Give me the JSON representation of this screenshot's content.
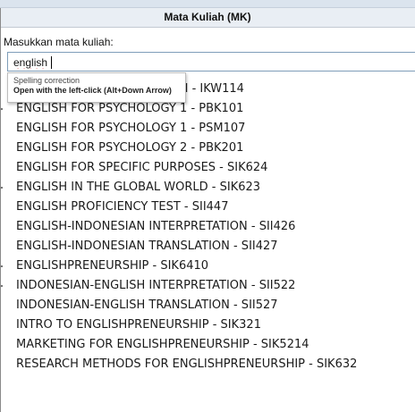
{
  "header": {
    "title": "Mata Kuliah (MK)"
  },
  "prompt": "Masukkan mata kuliah:",
  "search": {
    "value": "english"
  },
  "tooltip": {
    "title": "Spelling correction",
    "hint": "Open with the left-click (Alt+Down Arrow)"
  },
  "results": [
    "ENGLISH FOR ORGANIZATION - IKW114",
    "ENGLISH FOR PSYCHOLOGY 1 - PBK101",
    "ENGLISH FOR PSYCHOLOGY 1 - PSM107",
    "ENGLISH FOR PSYCHOLOGY 2 - PBK201",
    "ENGLISH FOR SPECIFIC PURPOSES - SIK624",
    "ENGLISH IN THE GLOBAL WORLD - SIK623",
    "ENGLISH PROFICIENCY TEST - SII447",
    "ENGLISH-INDONESIAN INTERPRETATION - SII426",
    "ENGLISH-INDONESIAN TRANSLATION - SII427",
    "ENGLISHPRENEURSHIP - SIK6410",
    "INDONESIAN-ENGLISH INTERPRETATION - SII522",
    "INDONESIAN-ENGLISH TRANSLATION - SII527",
    "INTRO TO ENGLISHPRENEURSHIP - SIK321",
    "MARKETING FOR ENGLISHPRENEURSHIP - SIK5214",
    "RESEARCH METHODS FOR ENGLISHPRENEURSHIP - SIK632"
  ]
}
